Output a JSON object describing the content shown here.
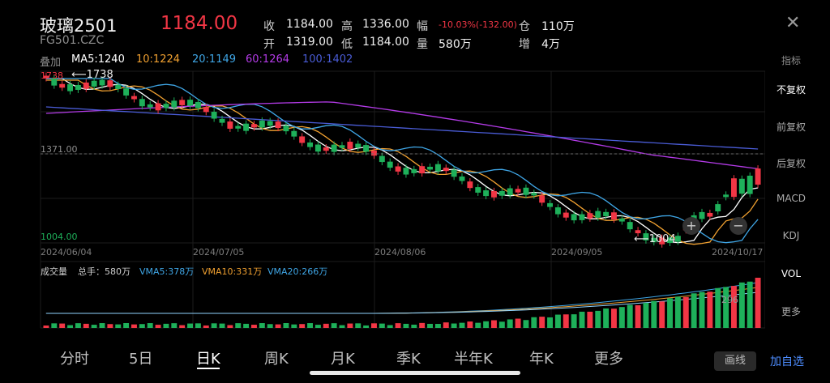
{
  "header": {
    "name": "玻璃2501",
    "code": "FG501.CZC",
    "price": "1184.00",
    "stats": {
      "close_label": "收",
      "close_val": "1184.00",
      "high_label": "高",
      "high_val": "1336.00",
      "amp_label": "幅",
      "amp_val": "-10.03%(-132.00)",
      "pos_label": "仓",
      "pos_val": "110万",
      "open_label": "开",
      "open_val": "1319.00",
      "low_label": "低",
      "low_val": "1184.00",
      "vol_label": "量",
      "vol_val": "580万",
      "inc_label": "增",
      "inc_val": "4万"
    }
  },
  "ma_bar": {
    "overlay": "叠加",
    "ma5": "MA5:1240",
    "ma10": "10:1224",
    "ma20": "20:1149",
    "ma60": "60:1264",
    "ma100": "100:1402"
  },
  "chart": {
    "top_left": "1738",
    "high_label": "1738",
    "ref_price": "1371.00",
    "low_price": "1004.00",
    "low_label": "1004",
    "dates": [
      "2024/06/04",
      "2024/07/05",
      "2024/08/06",
      "2024/09/05",
      "2024/10/17"
    ],
    "vol_title": "成交量",
    "vol_total": "总手：580万",
    "vma5": "VMA5:378万",
    "vma10": "VMA10:331万",
    "vma20": "VMA20:266万",
    "vol_mark": "296"
  },
  "side_menu": [
    "指标",
    "不复权",
    "前复权",
    "后复权",
    "MACD",
    "KDJ",
    "VOL",
    "更多"
  ],
  "bottom_tabs": [
    "分时",
    "5日",
    "日K",
    "周K",
    "月K",
    "季K",
    "半年K",
    "年K",
    "更多"
  ],
  "draw_label": "画线",
  "add_label": "加自选",
  "colors": {
    "up": "#f23645",
    "down": "#1eb05a",
    "ma5": "#ffffff",
    "ma10": "#f0a030",
    "ma20": "#3fa6e6",
    "ma60": "#b43be8",
    "ma100": "#4a5cd6"
  }
}
